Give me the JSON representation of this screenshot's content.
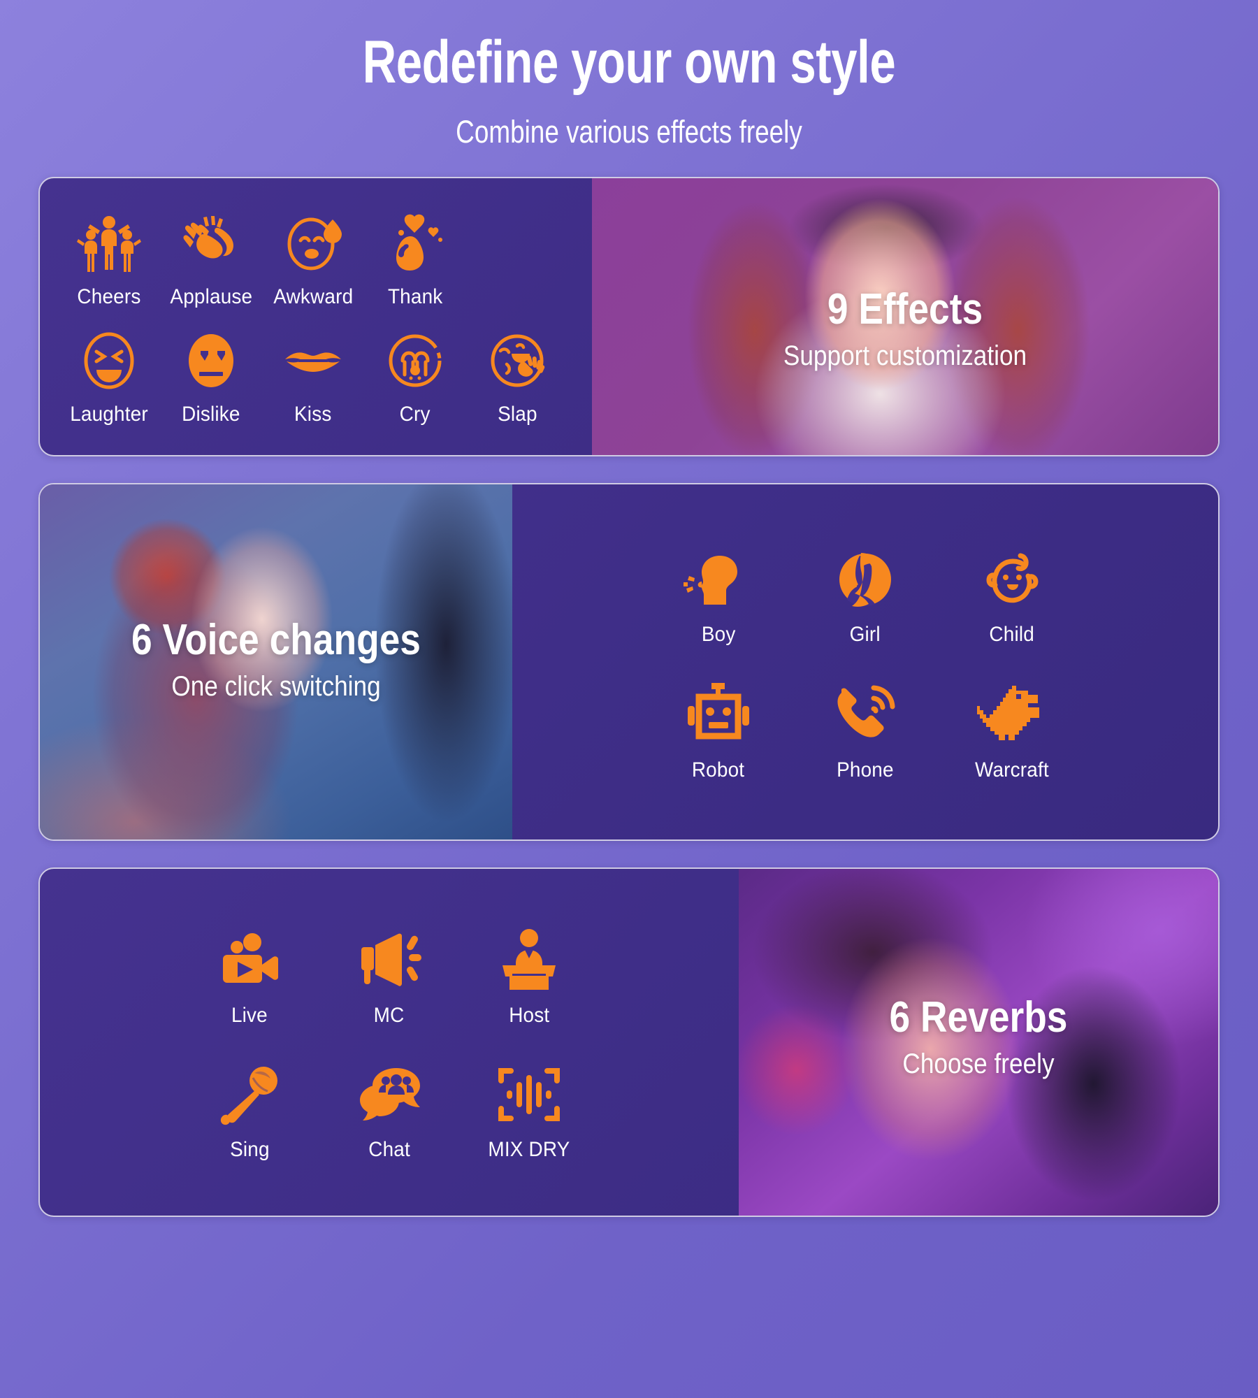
{
  "header": {
    "title": "Redefine your own style",
    "subtitle": "Combine various effects freely"
  },
  "colors": {
    "accent": "#F7881F",
    "card_bg": "#43308C",
    "page_bg": "#7d71d2",
    "text": "#FFFFFF",
    "card_border": "#CFCBE4"
  },
  "cards": [
    {
      "id": "effects",
      "photo": {
        "title": "9 Effects",
        "subtitle": "Support customization",
        "alt": "woman-with-headphones-laughing-at-microphone"
      },
      "rows": [
        [
          {
            "label": "Cheers",
            "icon": "cheers-icon"
          },
          {
            "label": "Applause",
            "icon": "applause-icon"
          },
          {
            "label": "Awkward",
            "icon": "awkward-icon"
          },
          {
            "label": "Thank",
            "icon": "thank-icon"
          }
        ],
        [
          {
            "label": "Laughter",
            "icon": "laughter-icon"
          },
          {
            "label": "Dislike",
            "icon": "dislike-icon"
          },
          {
            "label": "Kiss",
            "icon": "kiss-icon"
          },
          {
            "label": "Cry",
            "icon": "cry-icon"
          },
          {
            "label": "Slap",
            "icon": "slap-icon"
          }
        ]
      ]
    },
    {
      "id": "voice",
      "photo": {
        "title": "6 Voice changes",
        "subtitle": "One click switching",
        "alt": "woman-singing-into-studio-microphone"
      },
      "rows": [
        [
          {
            "label": "Boy",
            "icon": "boy-icon"
          },
          {
            "label": "Girl",
            "icon": "girl-icon"
          },
          {
            "label": "Child",
            "icon": "child-icon"
          }
        ],
        [
          {
            "label": "Robot",
            "icon": "robot-icon"
          },
          {
            "label": "Phone",
            "icon": "phone-icon"
          },
          {
            "label": "Warcraft",
            "icon": "dinosaur-icon"
          }
        ]
      ]
    },
    {
      "id": "reverb",
      "photo": {
        "title": "6 Reverbs",
        "subtitle": "Choose freely",
        "alt": "man-with-gaming-headset-at-microphone"
      },
      "rows": [
        [
          {
            "label": "Live",
            "icon": "video-camera-icon"
          },
          {
            "label": "MC",
            "icon": "megaphone-icon"
          },
          {
            "label": "Host",
            "icon": "podium-speaker-icon"
          }
        ],
        [
          {
            "label": "Sing",
            "icon": "microphone-icon"
          },
          {
            "label": "Chat",
            "icon": "group-chat-icon"
          },
          {
            "label": "MIX DRY",
            "icon": "waveform-scan-icon"
          }
        ]
      ]
    }
  ]
}
